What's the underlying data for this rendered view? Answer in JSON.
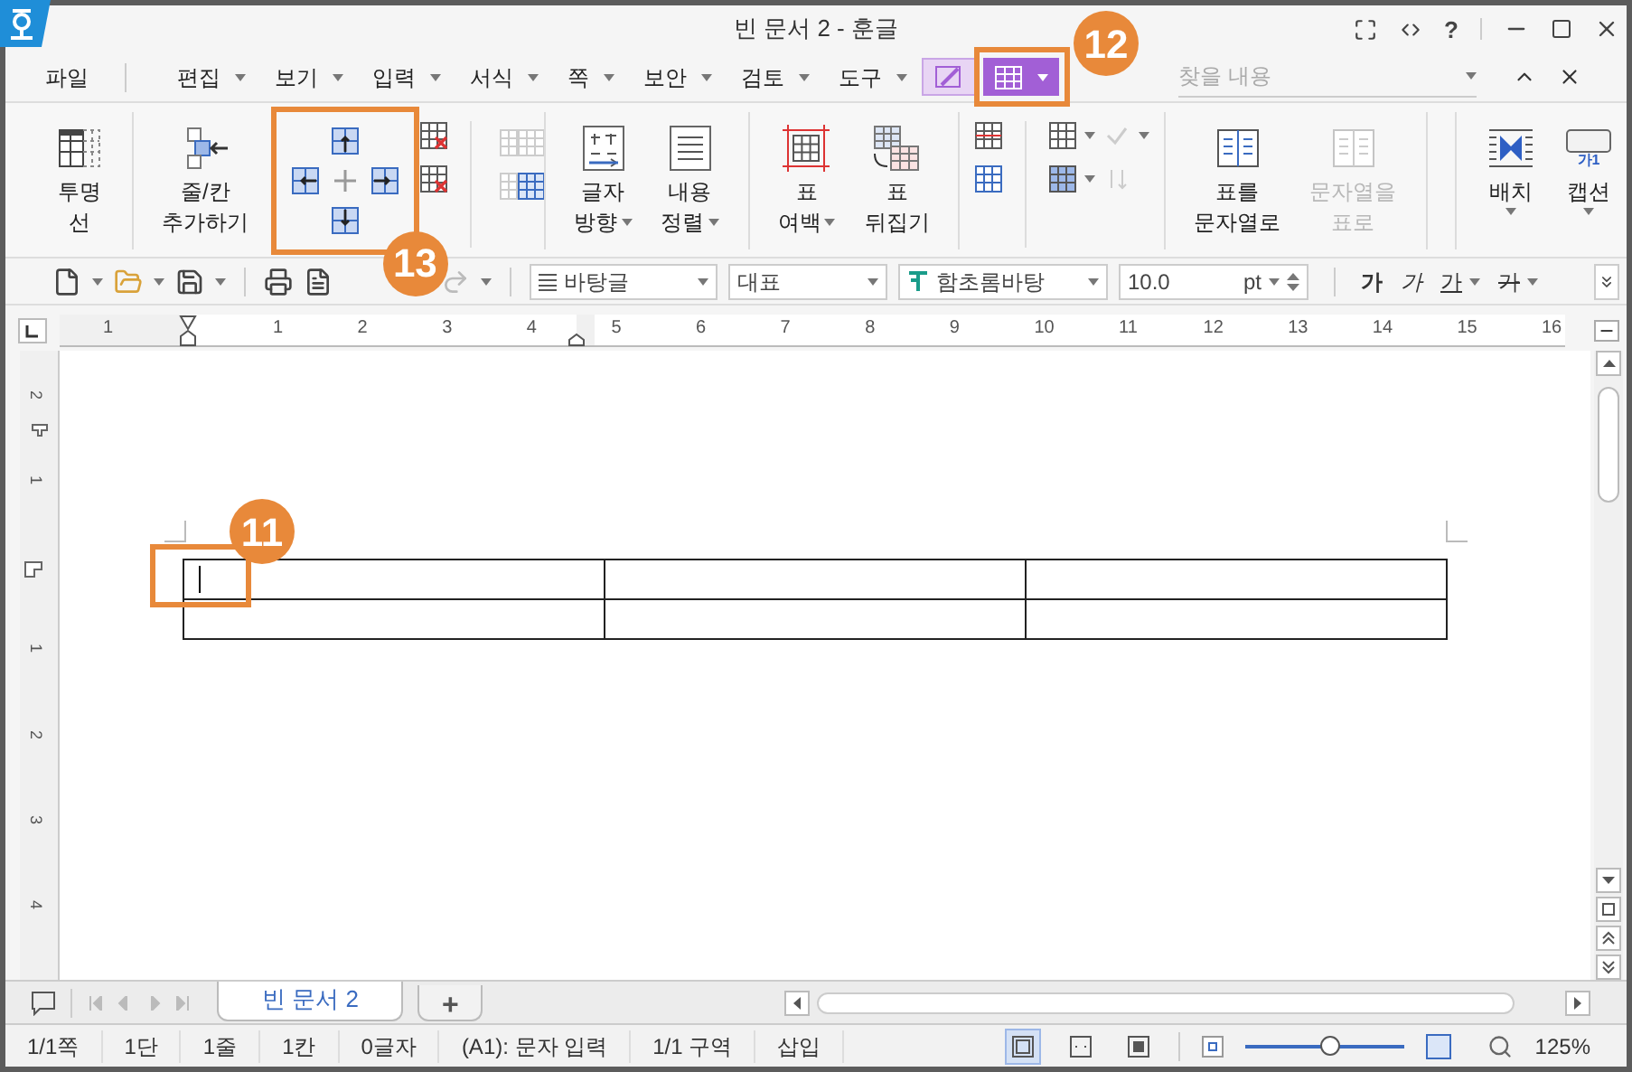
{
  "window": {
    "title": "빈 문서 2 - 훈글",
    "help": "?"
  },
  "menu": [
    {
      "label": "파일",
      "dropdown": false
    },
    {
      "label": "편집",
      "dropdown": true
    },
    {
      "label": "보기",
      "dropdown": true
    },
    {
      "label": "입력",
      "dropdown": true
    },
    {
      "label": "서식",
      "dropdown": true
    },
    {
      "label": "쪽",
      "dropdown": true
    },
    {
      "label": "보안",
      "dropdown": true
    },
    {
      "label": "검토",
      "dropdown": true
    },
    {
      "label": "도구",
      "dropdown": true
    }
  ],
  "context_tabs": [
    {
      "kind": "edit",
      "selected": false
    },
    {
      "kind": "table",
      "selected": true
    }
  ],
  "search": {
    "placeholder": "찾을 내용"
  },
  "ribbon": [
    {
      "kind": "transparent",
      "lines": [
        "투명",
        "선"
      ],
      "dropdown": false,
      "disabled": false
    },
    {
      "kind": "addrow",
      "lines": [
        "줄/칸",
        "추가하기"
      ],
      "dropdown": false,
      "disabled": false
    },
    {
      "kind": "cluster"
    },
    {
      "kind": "textdir",
      "lines": [
        "글자",
        "방향"
      ],
      "dropdown": true,
      "disabled": false
    },
    {
      "kind": "align",
      "lines": [
        "내용",
        "정렬"
      ],
      "dropdown": true,
      "disabled": false
    },
    {
      "kind": "margin",
      "lines": [
        "표",
        "여백"
      ],
      "dropdown": true,
      "disabled": false
    },
    {
      "kind": "flip",
      "lines": [
        "표",
        "뒤집기"
      ],
      "dropdown": false,
      "disabled": false
    },
    {
      "kind": "smalls"
    },
    {
      "kind": "totext",
      "lines": [
        "표를",
        "문자열로"
      ],
      "dropdown": false,
      "disabled": false
    },
    {
      "kind": "totext",
      "lines": [
        "문자열을",
        "표로"
      ],
      "dropdown": false,
      "disabled": true
    },
    {
      "kind": "place",
      "lines": [
        "배치"
      ],
      "dropdown": true,
      "disabled": false
    },
    {
      "kind": "caption",
      "lines": [
        "캡션"
      ],
      "dropdown": true,
      "disabled": false
    }
  ],
  "caption_icon_text": "가1",
  "toolbar": {
    "style": "바탕글",
    "paragraph": "대표",
    "font": "함초롬바탕",
    "size": "10.0",
    "unit": "pt",
    "format": [
      {
        "kind": "bold",
        "label": "가",
        "dropdown": false
      },
      {
        "kind": "italic",
        "label": "가",
        "dropdown": false
      },
      {
        "kind": "underline",
        "label": "가",
        "dropdown": true
      },
      {
        "kind": "strike",
        "label": "가",
        "dropdown": true
      }
    ]
  },
  "ruler": {
    "marks": [
      "1",
      "1",
      "2",
      "3",
      "4",
      "5",
      "6",
      "7",
      "8",
      "9",
      "10",
      "11",
      "12",
      "13",
      "14",
      "15",
      "16"
    ]
  },
  "vertical_ruler": {
    "marks": [
      "2",
      "1",
      "1",
      "2",
      "3",
      "4"
    ]
  },
  "table": {
    "rows": [
      [
        {
          "cursor": true
        },
        {
          "cursor": false
        },
        {
          "cursor": false
        }
      ],
      [
        {
          "cursor": false
        },
        {
          "cursor": false
        },
        {
          "cursor": false
        }
      ]
    ]
  },
  "callouts": [
    "11",
    "12",
    "13"
  ],
  "doc_tabs": [
    {
      "label": "빈 문서 2",
      "selected": true
    }
  ],
  "add_tab": "+",
  "status_bar": [
    "1/1쪽",
    "1단",
    "1줄",
    "1칸",
    "0글자",
    "(A1): 문자 입력",
    "1/1 구역",
    "삽입"
  ],
  "view_modes": [
    {
      "selected": true
    },
    {
      "selected": false
    },
    {
      "selected": false
    }
  ],
  "zoom": {
    "level": 0.53,
    "reading": "125%"
  }
}
